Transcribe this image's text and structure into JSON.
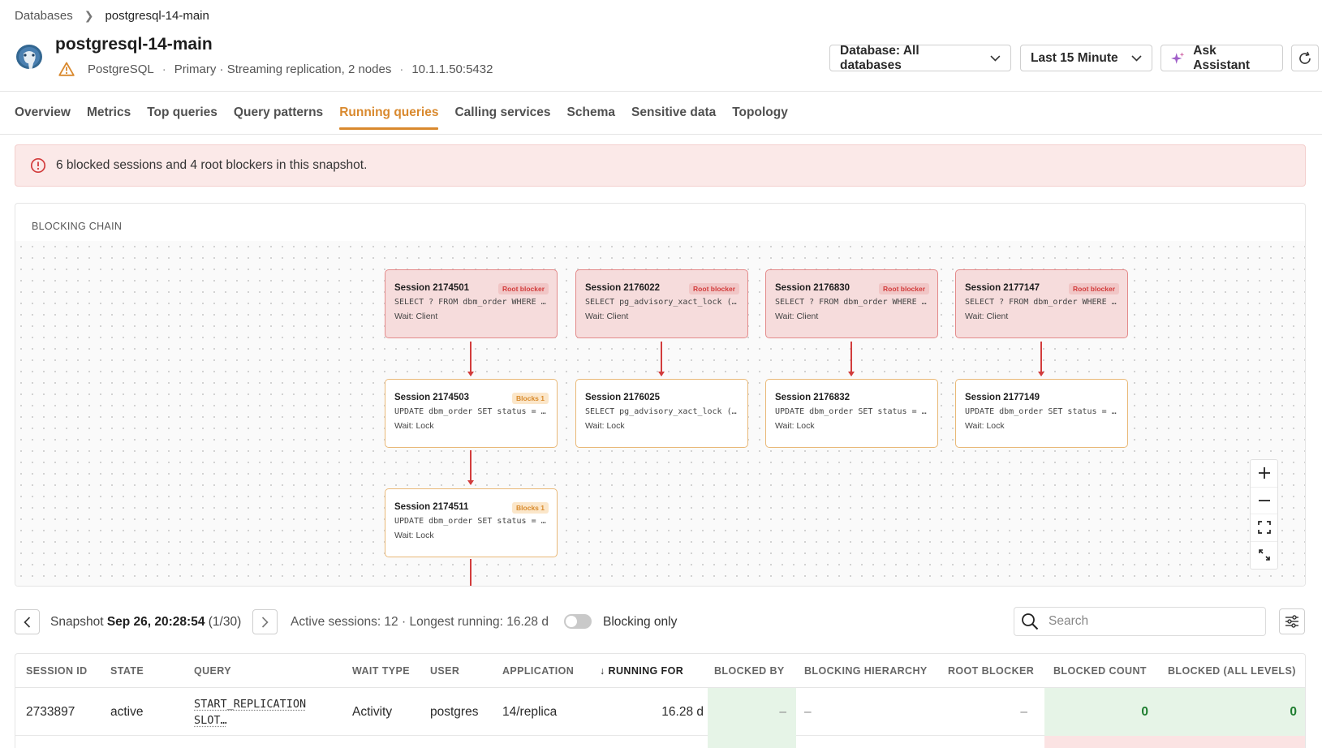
{
  "breadcrumb": {
    "parent": "Databases",
    "current": "postgresql-14-main"
  },
  "header": {
    "title": "postgresql-14-main",
    "engine": "PostgreSQL",
    "role": "Primary · Streaming replication, 2 nodes",
    "host": "10.1.1.50:5432",
    "database_button": "Database: All databases",
    "time_button": "Last 15 Minute",
    "ask_button": "Ask Assistant"
  },
  "tabs": [
    "Overview",
    "Metrics",
    "Top queries",
    "Query patterns",
    "Running queries",
    "Calling services",
    "Schema",
    "Sensitive data",
    "Topology"
  ],
  "active_tab": "Running queries",
  "alert": {
    "text": "6 blocked sessions and 4 root blockers in this snapshot.",
    "color": "#d23c3c"
  },
  "chain": {
    "label": "BLOCKING CHAIN",
    "roots": [
      {
        "title": "Session 2174501",
        "badge": "Root blocker",
        "query": "SELECT ? FROM dbm_order WHERE i…",
        "wait": "Wait: Client"
      },
      {
        "title": "Session 2176022",
        "badge": "Root blocker",
        "query": "SELECT pg_advisory_xact_lock ( …",
        "wait": "Wait: Client"
      },
      {
        "title": "Session 2176830",
        "badge": "Root blocker",
        "query": "SELECT ? FROM dbm_order WHERE i…",
        "wait": "Wait: Client"
      },
      {
        "title": "Session 2177147",
        "badge": "Root blocker",
        "query": "SELECT ? FROM dbm_order WHERE i…",
        "wait": "Wait: Client"
      }
    ],
    "children": [
      {
        "title": "Session 2174503",
        "badge": "Blocks 1",
        "query": "UPDATE dbm_order SET status = s…",
        "wait": "Wait: Lock"
      },
      {
        "title": "Session 2176025",
        "badge": "",
        "query": "SELECT pg_advisory_xact_lock ( …",
        "wait": "Wait: Lock"
      },
      {
        "title": "Session 2176832",
        "badge": "",
        "query": "UPDATE dbm_order SET status = s…",
        "wait": "Wait: Lock"
      },
      {
        "title": "Session 2177149",
        "badge": "",
        "query": "UPDATE dbm_order SET status = s…",
        "wait": "Wait: Lock"
      }
    ],
    "grandchildren": [
      {
        "title": "Session 2174511",
        "badge": "Blocks 1",
        "query": "UPDATE dbm_order SET status = s…",
        "wait": "Wait: Lock"
      }
    ]
  },
  "snapshot": {
    "prefix": "Snapshot",
    "timestamp": "Sep 26, 20:28:54",
    "position": "(1/30)",
    "stats": "Active sessions: 12 · Longest running: 16.28 d",
    "blocking_only_label": "Blocking only",
    "blocking_only": false,
    "search_placeholder": "Search"
  },
  "table": {
    "columns": [
      "SESSION ID",
      "STATE",
      "QUERY",
      "WAIT TYPE",
      "USER",
      "APPLICATION",
      "RUNNING FOR",
      "BLOCKED BY",
      "BLOCKING HIERARCHY",
      "ROOT BLOCKER",
      "BLOCKED COUNT",
      "BLOCKED (ALL LEVELS)"
    ],
    "sort_column": "RUNNING FOR",
    "rows": [
      {
        "session_id": "2733897",
        "state": "active",
        "query": "START_REPLICATION SLOT…",
        "wait_type": "Activity",
        "user": "postgres",
        "application": "14/replica",
        "running_for": "16.28 d",
        "blocked_by": "–",
        "blocking_hierarchy": "–",
        "root_blocker": "–",
        "blocked_count": "0",
        "blocked_all_levels": "0"
      }
    ]
  }
}
